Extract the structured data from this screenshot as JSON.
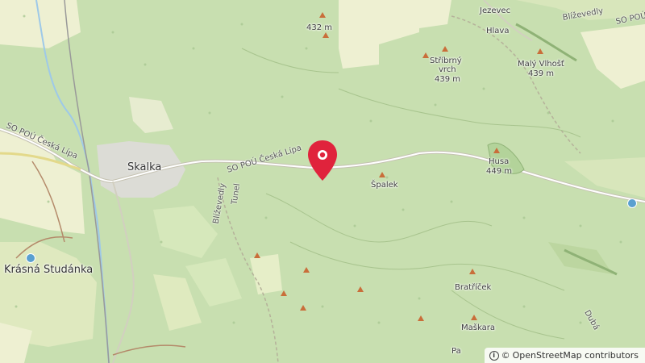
{
  "map": {
    "places": {
      "skalka": "Skalka",
      "krasna": "Krásná Studánka",
      "jezevec": "Jezevec",
      "hlava": "Hlava",
      "spalek": "Špalek",
      "bratricek": "Bratříček",
      "maskara": "Maškara",
      "pa": "Pa"
    },
    "peaks": {
      "p432": "432 m",
      "stribrny_name1": "Stříbrný",
      "stribrny_name2": "vrch",
      "stribrny_elev": "439 m",
      "vlhost_name": "Malý Vlhošť",
      "vlhost_elev": "439 m",
      "husa_name": "Husa",
      "husa_elev": "449 m"
    },
    "roads": {
      "sopou_west": "SO POÚ Česká Lípa",
      "sopou_mid": "SO POÚ Česká Lípa",
      "sopou_ne": "SO POÚ",
      "blizevedly_v": "Blíževedly",
      "blizevedly_ne": "Blíževedly",
      "tunel": "Tunel",
      "dubá": "Dubá"
    },
    "marker_icon": "location-pin-icon",
    "colors": {
      "forest": "#c8dfb0",
      "meadow": "#eef0d2",
      "marker": "#e0233c",
      "peak": "#c96e3a"
    }
  },
  "attribution": {
    "symbol": "©",
    "text": "OpenStreetMap contributors",
    "info_icon": "i"
  }
}
